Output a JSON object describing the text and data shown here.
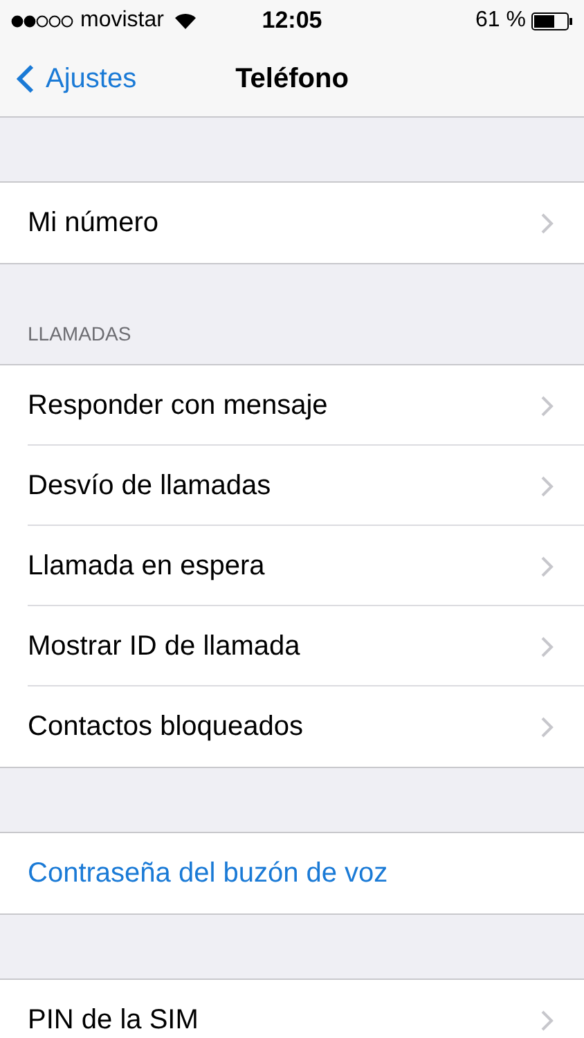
{
  "status_bar": {
    "carrier": "movistar",
    "time": "12:05",
    "battery": "61 %"
  },
  "nav": {
    "back": "Ajustes",
    "title": "Teléfono"
  },
  "sections": [
    {
      "rows": [
        {
          "label": "Mi número",
          "kind": "nav"
        }
      ]
    },
    {
      "header": "LLAMADAS",
      "rows": [
        {
          "label": "Responder con mensaje",
          "kind": "nav"
        },
        {
          "label": "Desvío de llamadas",
          "kind": "nav"
        },
        {
          "label": "Llamada en espera",
          "kind": "nav"
        },
        {
          "label": "Mostrar ID de llamada",
          "kind": "nav"
        },
        {
          "label": "Contactos bloqueados",
          "kind": "nav"
        }
      ]
    },
    {
      "rows": [
        {
          "label": "Contraseña del buzón de voz",
          "kind": "link"
        }
      ]
    },
    {
      "rows": [
        {
          "label": "PIN de la SIM",
          "kind": "nav"
        }
      ]
    }
  ]
}
